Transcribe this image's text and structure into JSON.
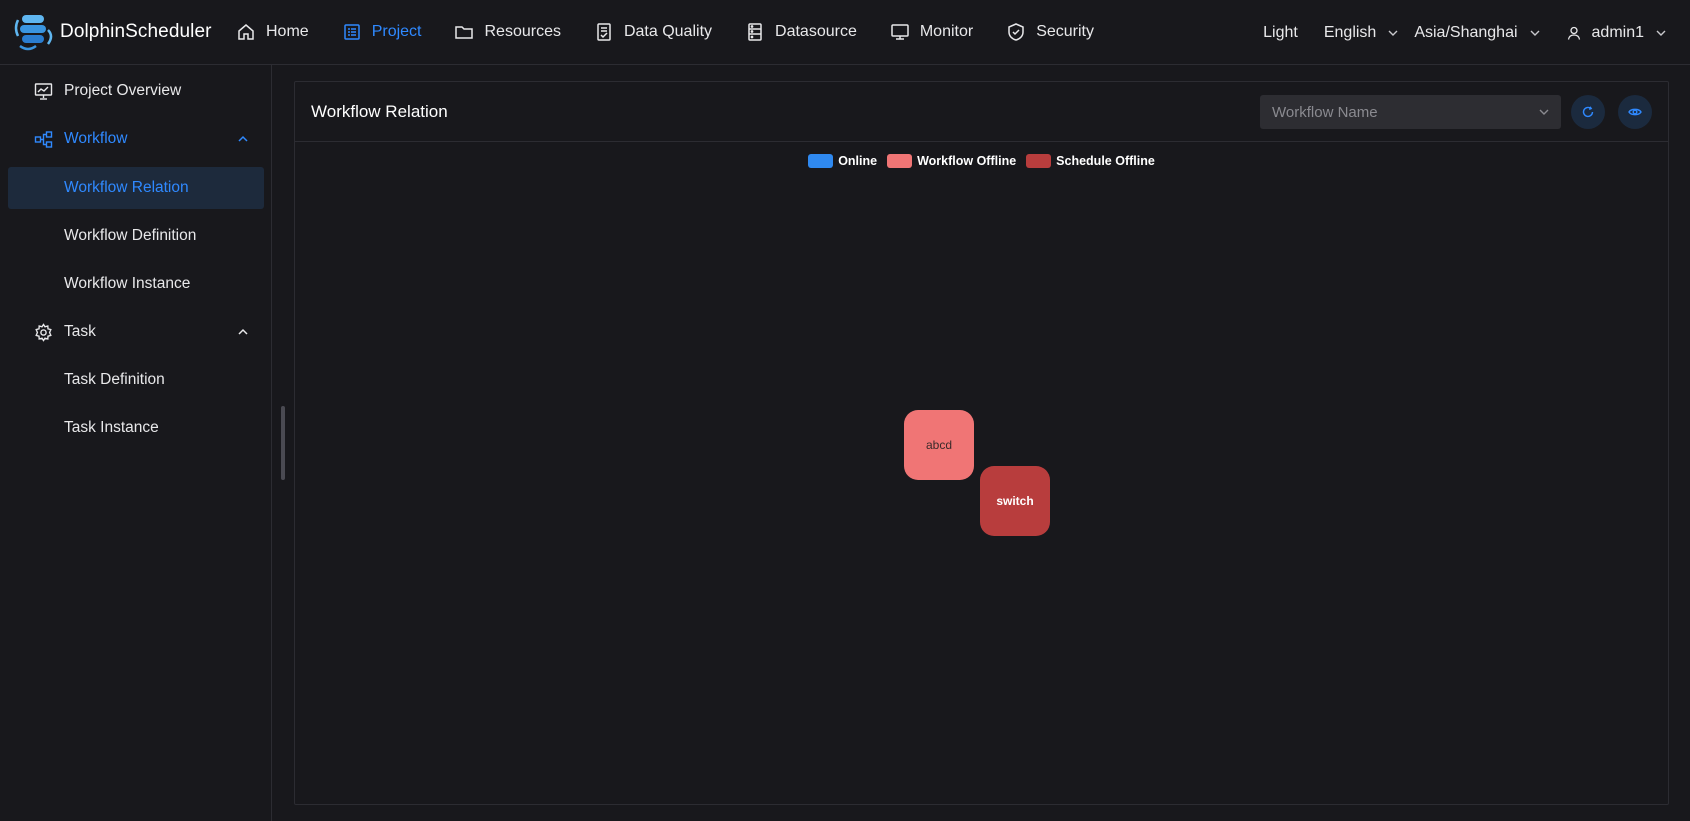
{
  "app": {
    "name": "DolphinScheduler"
  },
  "nav": [
    {
      "key": "home",
      "label": "Home",
      "active": false
    },
    {
      "key": "project",
      "label": "Project",
      "active": true
    },
    {
      "key": "resources",
      "label": "Resources",
      "active": false
    },
    {
      "key": "data_quality",
      "label": "Data Quality",
      "active": false
    },
    {
      "key": "datasource",
      "label": "Datasource",
      "active": false
    },
    {
      "key": "monitor",
      "label": "Monitor",
      "active": false
    },
    {
      "key": "security",
      "label": "Security",
      "active": false
    }
  ],
  "header_tools": {
    "theme": "Light",
    "language": "English",
    "timezone": "Asia/Shanghai",
    "user": "admin1"
  },
  "sidebar": {
    "items": [
      {
        "label": "Project Overview"
      },
      {
        "label": "Workflow"
      },
      {
        "label": "Workflow Relation"
      },
      {
        "label": "Workflow Definition"
      },
      {
        "label": "Workflow Instance"
      },
      {
        "label": "Task"
      },
      {
        "label": "Task Definition"
      },
      {
        "label": "Task Instance"
      }
    ]
  },
  "main": {
    "title": "Workflow Relation",
    "select_placeholder": "Workflow Name",
    "legend": [
      {
        "label": "Online",
        "color": "#2f89f0"
      },
      {
        "label": "Workflow Offline",
        "color": "#f07575"
      },
      {
        "label": "Schedule Offline",
        "color": "#b83d3d"
      }
    ],
    "nodes": [
      {
        "label": "abcd",
        "status": "Workflow Offline",
        "color": "#f07575"
      },
      {
        "label": "switch",
        "status": "Schedule Offline",
        "color": "#b83d3d"
      }
    ]
  },
  "colors": {
    "accent": "#2f89ff",
    "background": "#18181c",
    "selected_bg": "#1d2a3c"
  }
}
